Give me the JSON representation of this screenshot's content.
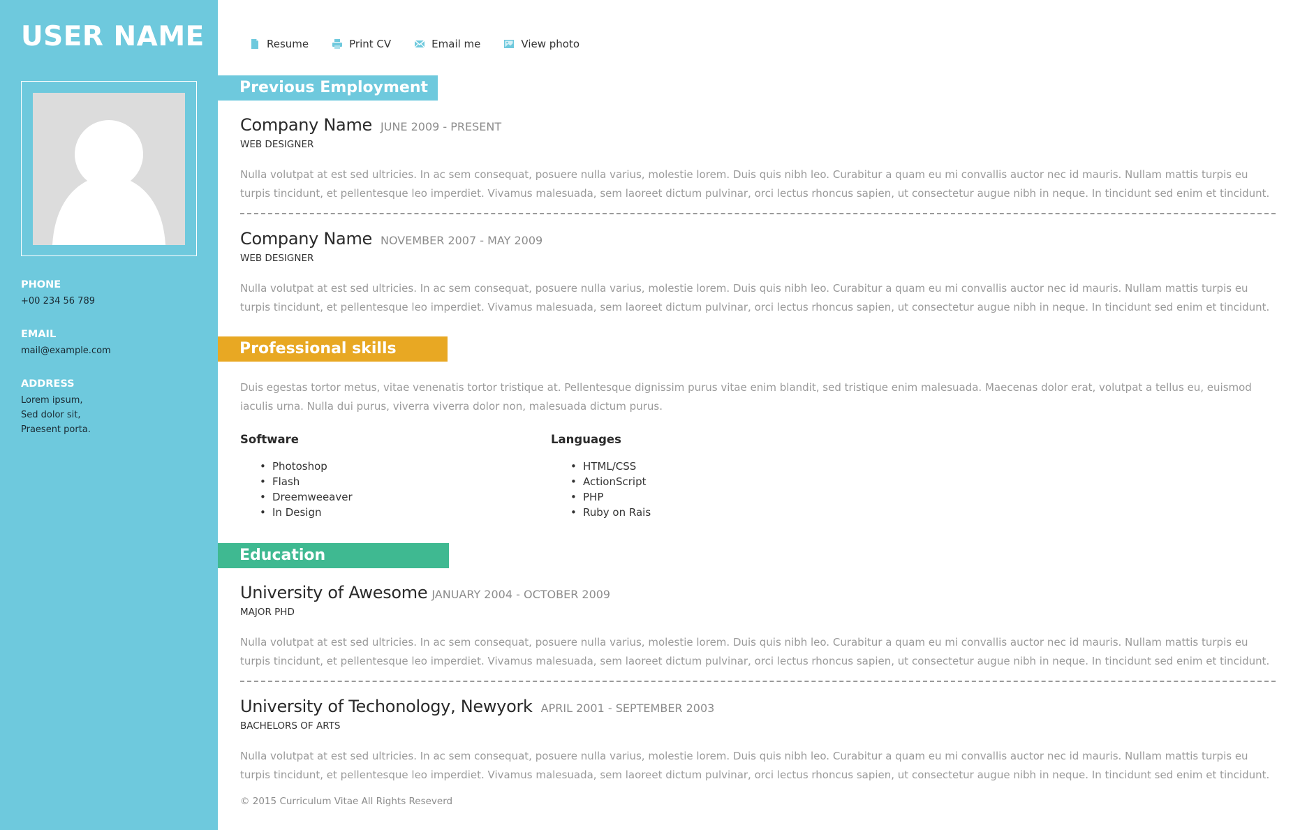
{
  "sidebar": {
    "user_name": "USER NAME",
    "photo_icon": "user-silhouette-icon",
    "contact": {
      "phone_label": "PHONE",
      "phone_value": "+00 234 56 789",
      "email_label": "EMAIL",
      "email_value": "mail@example.com",
      "address_label": "ADDRESS",
      "address_lines": [
        "Lorem ipsum,",
        "Sed dolor sit,",
        "Praesent porta."
      ]
    }
  },
  "nav": {
    "items": [
      {
        "label": "Resume",
        "icon": "document-icon"
      },
      {
        "label": "Print CV",
        "icon": "printer-icon"
      },
      {
        "label": "Email me",
        "icon": "envelope-icon"
      },
      {
        "label": "View photo",
        "icon": "image-icon"
      }
    ]
  },
  "employment": {
    "title": "Previous Employment",
    "entries": [
      {
        "name": "Company Name",
        "dates": "JUNE 2009 - PRESENT",
        "role": "WEB DESIGNER",
        "description": "Nulla volutpat at est sed ultricies. In ac sem consequat, posuere nulla varius, molestie lorem. Duis quis nibh leo. Curabitur a quam eu mi convallis auctor nec id mauris. Nullam mattis turpis eu turpis tincidunt, et pellentesque leo imperdiet. Vivamus malesuada, sem laoreet dictum pulvinar, orci lectus rhoncus sapien, ut consectetur augue nibh in neque. In tincidunt sed enim et tincidunt."
      },
      {
        "name": "Company Name",
        "dates": "NOVEMBER 2007 - MAY 2009",
        "role": "WEB DESIGNER",
        "description": "Nulla volutpat at est sed ultricies. In ac sem consequat, posuere nulla varius, molestie lorem. Duis quis nibh leo. Curabitur a quam eu mi convallis auctor nec id mauris. Nullam mattis turpis eu turpis tincidunt, et pellentesque leo imperdiet. Vivamus malesuada, sem laoreet dictum pulvinar, orci lectus rhoncus sapien, ut consectetur augue nibh in neque. In tincidunt sed enim et tincidunt."
      }
    ]
  },
  "skills": {
    "title": "Professional skills",
    "description": "Duis egestas tortor metus, vitae venenatis tortor tristique at. Pellentesque dignissim purus vitae enim blandit, sed tristique enim malesuada. Maecenas dolor erat, volutpat a tellus eu, euismod iaculis urna. Nulla dui purus, viverra viverra dolor non, malesuada dictum purus.",
    "software": {
      "heading": "Software",
      "items": [
        "Photoshop",
        "Flash",
        "Dreemweeaver",
        "In Design"
      ]
    },
    "languages": {
      "heading": "Languages",
      "items": [
        "HTML/CSS",
        "ActionScript",
        "PHP",
        "Ruby on Rais"
      ]
    }
  },
  "education": {
    "title": "Education",
    "entries": [
      {
        "name": "University of Awesome",
        "dates": "JANUARY 2004 - OCTOBER 2009",
        "role": "MAJOR PHD",
        "description": "Nulla volutpat at est sed ultricies. In ac sem consequat, posuere nulla varius, molestie lorem. Duis quis nibh leo. Curabitur a quam eu mi convallis auctor nec id mauris. Nullam mattis turpis eu turpis tincidunt, et pellentesque leo imperdiet. Vivamus malesuada, sem laoreet dictum pulvinar, orci lectus rhoncus sapien, ut consectetur augue nibh in neque. In tincidunt sed enim et tincidunt."
      },
      {
        "name": "University of Techonology, Newyork",
        "dates": "APRIL 2001 - SEPTEMBER 2003",
        "role": "BACHELORS OF ARTS",
        "description": "Nulla volutpat at est sed ultricies. In ac sem consequat, posuere nulla varius, molestie lorem. Duis quis nibh leo. Curabitur a quam eu mi convallis auctor nec id mauris. Nullam mattis turpis eu turpis tincidunt, et pellentesque leo imperdiet. Vivamus malesuada, sem laoreet dictum pulvinar, orci lectus rhoncus sapien, ut consectetur augue nibh in neque. In tincidunt sed enim et tincidunt."
      }
    ]
  },
  "footer": {
    "copyright": "© 2015 Curriculum Vitae All Rights Reseverd"
  },
  "colors": {
    "sidebar": "#6ec9dd",
    "employment_bar": "#6ec9dd",
    "skills_bar": "#e8a823",
    "education_bar": "#3fb991"
  }
}
